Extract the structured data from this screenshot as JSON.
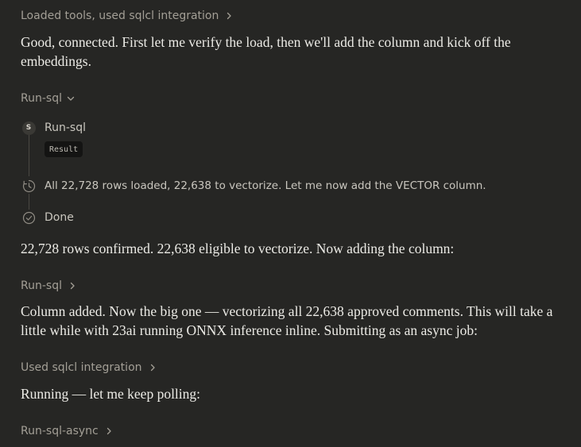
{
  "thread": {
    "summary_top": "Loaded tools, used sqlcl integration",
    "msg1": "Good, connected. First let me verify the load, then we'll add the column and kick off the embeddings.",
    "tool1_label": "Run-sql",
    "timeline": {
      "step1_badge": "S",
      "step1_label": "Run-sql",
      "step1_result": "Result",
      "step2_text": "All 22,728 rows loaded, 22,638 to vectorize. Let me now add the VECTOR column.",
      "step3_text": "Done"
    },
    "msg2": "22,728 rows confirmed. 22,638 eligible to vectorize. Now adding the column:",
    "tool2_label": "Run-sql",
    "msg3": "Column added. Now the big one — vectorizing all 22,638 approved comments. This will take a little while with 23ai running ONNX inference inline. Submitting as an async job:",
    "tool3_label": "Used sqlcl integration",
    "msg4": "Running — let me keep polling:",
    "tool4_label": "Run-sql-async"
  },
  "icons": {
    "chevron_right": "chevron-right-icon",
    "chevron_down": "chevron-down-icon",
    "clock": "clock-icon",
    "check": "check-circle-icon"
  },
  "colors": {
    "background": "#262624",
    "text": "#ecebe6",
    "muted": "#a39f96"
  }
}
